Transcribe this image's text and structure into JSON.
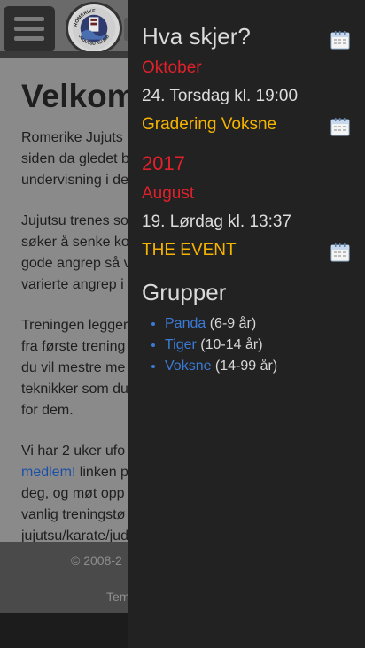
{
  "background_page": {
    "logo_text": "ROMERIKE JUJUTSU KLUBB",
    "heading": "Velkom",
    "paragraphs": [
      [
        "Romerike Jujuts",
        "siden da gledet b",
        "undervisning i de"
      ],
      [
        "Jujutsu trenes so",
        "søker å senke ko",
        "gode angrep så v",
        "varierte angrep i"
      ],
      [
        "Treningen legger",
        "fra første trening",
        "du vil mestre me",
        "teknikker som du",
        "for dem."
      ]
    ],
    "last_paragraph": {
      "line1": "Vi har 2 uker ufo",
      "link": "medlem!",
      "link_rest": " linken p",
      "rest": [
        "deg, og møt opp",
        "vanlig treningstø",
        "jujutsu/karate/jud"
      ]
    },
    "footer_text": "© 2008-2",
    "footer_link": "Tem"
  },
  "drawer": {
    "events_heading": "Hva skjer?",
    "events": [
      {
        "month": "Oktober",
        "date": "24. Torsdag kl. 19:00",
        "title": "Gradering Voksne"
      },
      {
        "year": "2017",
        "month": "August",
        "date": "19. Lørdag kl. 13:37",
        "title": "THE EVENT"
      }
    ],
    "groups_heading": "Grupper",
    "groups": [
      {
        "name": "Panda",
        "age": " (6-9 år)"
      },
      {
        "name": "Tiger",
        "age": " (10-14 år)"
      },
      {
        "name": "Voksne",
        "age": " (14-99 år)"
      }
    ]
  },
  "colors": {
    "month": "#e0212b",
    "event_title": "#f6b400",
    "link": "#3b7bd6",
    "drawer_bg": "#222222"
  },
  "icons": {
    "menu": "hamburger-menu-icon",
    "calendar": "calendar-icon"
  }
}
